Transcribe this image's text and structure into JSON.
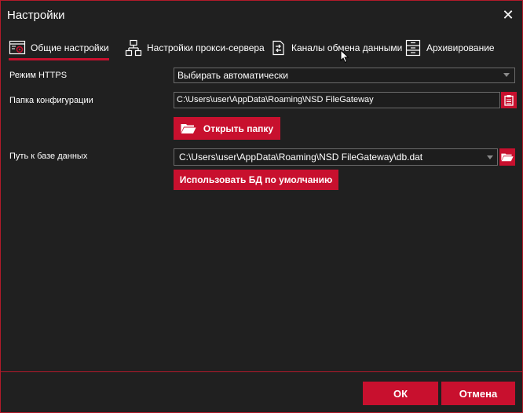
{
  "window": {
    "title": "Настройки",
    "close_glyph": "✕"
  },
  "tabs": [
    {
      "label": "Общие настройки",
      "icon": "settings-window-icon",
      "active": true
    },
    {
      "label": "Настройки прокси-сервера",
      "icon": "network-icon",
      "active": false
    },
    {
      "label": "Каналы обмена данными",
      "icon": "exchange-icon",
      "active": false
    },
    {
      "label": "Архивирование",
      "icon": "archive-icon",
      "active": false
    }
  ],
  "fields": {
    "https_mode": {
      "label": "Режим HTTPS",
      "value": "Выбирать автоматически"
    },
    "config_folder": {
      "label": "Папка конфигурации",
      "value": "C:\\Users\\user\\AppData\\Roaming\\NSD FileGateway",
      "open_button": "Открыть папку"
    },
    "db_path": {
      "label": "Путь к базе данных",
      "value": "C:\\Users\\user\\AppData\\Roaming\\NSD FileGateway\\db.dat",
      "default_button": "Использовать БД по умолчанию"
    }
  },
  "footer": {
    "ok_label": "ОК",
    "cancel_label": "Отмена"
  },
  "colors": {
    "accent": "#c8102e",
    "background": "#202020"
  }
}
